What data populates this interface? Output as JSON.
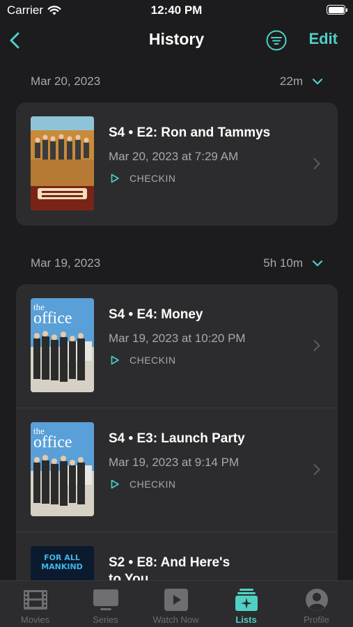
{
  "status_bar": {
    "carrier": "Carrier",
    "time": "12:40 PM"
  },
  "nav": {
    "title": "History",
    "edit_label": "Edit"
  },
  "colors": {
    "accent": "#4fd1c5",
    "background": "#1c1c1e",
    "card": "#2c2c2e",
    "secondary_text": "#a8a8ad",
    "tab_inactive": "#6d6d72"
  },
  "sections": [
    {
      "date": "Mar 20, 2023",
      "duration": "22m",
      "items": [
        {
          "title": "S4 • E2: Ron and Tammys",
          "datetime": "Mar 20, 2023 at 7:29 AM",
          "action": "CHECKIN",
          "poster": "Parks and Recreation"
        }
      ]
    },
    {
      "date": "Mar 19, 2023",
      "duration": "5h 10m",
      "items": [
        {
          "title": "S4 • E4: Money",
          "datetime": "Mar 19, 2023 at 10:20 PM",
          "action": "CHECKIN",
          "poster": "the office"
        },
        {
          "title": "S4 • E3: Launch Party",
          "datetime": "Mar 19, 2023 at 9:14 PM",
          "action": "CHECKIN",
          "poster": "the office"
        },
        {
          "title": "S2 • E8: And Here's",
          "title_line2": "to You",
          "poster": "FOR ALL MANKIND"
        }
      ]
    }
  ],
  "tabs": [
    {
      "label": "Movies",
      "icon": "film-icon",
      "active": false
    },
    {
      "label": "Series",
      "icon": "tv-icon",
      "active": false
    },
    {
      "label": "Watch Now",
      "icon": "play-square-icon",
      "active": false
    },
    {
      "label": "Lists",
      "icon": "lists-icon",
      "active": true
    },
    {
      "label": "Profile",
      "icon": "profile-icon",
      "active": false
    }
  ]
}
